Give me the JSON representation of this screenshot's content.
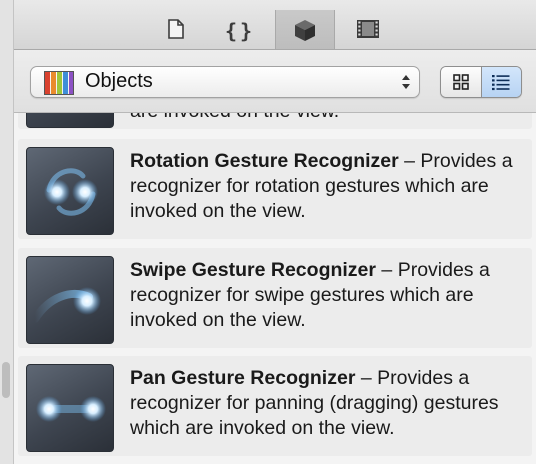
{
  "inspector_tabs": [
    {
      "name": "file",
      "icon": "file-icon",
      "active": false
    },
    {
      "name": "code",
      "icon": "braces-icon",
      "active": false
    },
    {
      "name": "object",
      "icon": "cube-icon",
      "active": true
    },
    {
      "name": "media",
      "icon": "film-icon",
      "active": false
    }
  ],
  "braces_glyph": "{}",
  "library": {
    "selected_label": "Objects",
    "view_modes": [
      "grid",
      "list"
    ],
    "active_view": "list"
  },
  "items": [
    {
      "title": "",
      "separator": "",
      "description": "are invoked on the view."
    },
    {
      "title": "Rotation Gesture Recognizer",
      "separator": " – ",
      "description": "Provides a recognizer for rotation gestures which are invoked on the view."
    },
    {
      "title": "Swipe Gesture Recognizer",
      "separator": " – ",
      "description": "Provides a recognizer for swipe gestures which are invoked on the view."
    },
    {
      "title": "Pan Gesture Recognizer",
      "separator": " – ",
      "description": "Provides a recognizer for panning (dragging) gestures which are invoked on the view."
    }
  ]
}
